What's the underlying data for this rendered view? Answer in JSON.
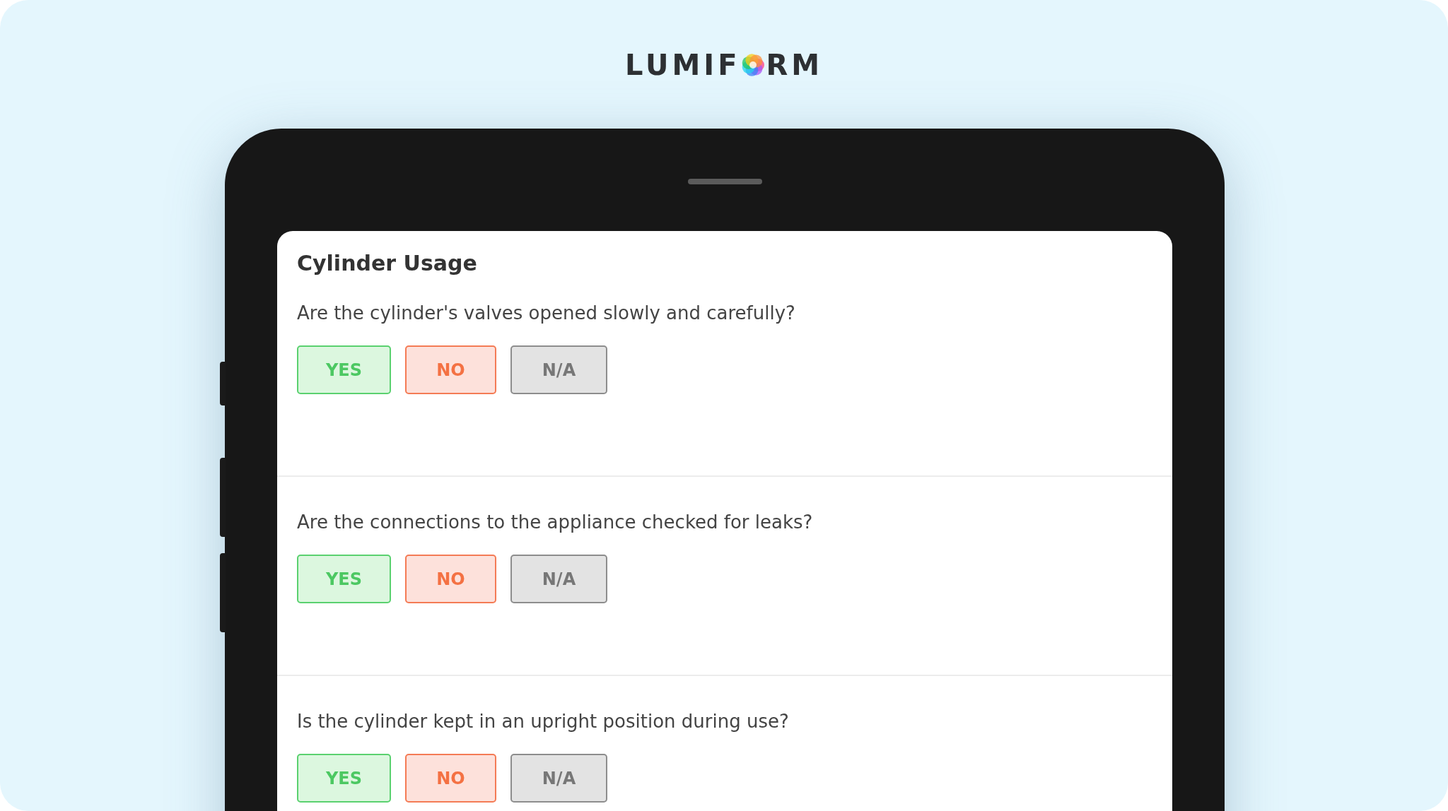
{
  "logo": {
    "before": "LUMIF",
    "after": "RM"
  },
  "form": {
    "title": "Cylinder Usage",
    "questions": [
      {
        "text": "Are the cylinder's valves opened slowly and carefully?",
        "options": [
          {
            "kind": "yes",
            "label": "YES",
            "selected": false
          },
          {
            "kind": "no",
            "label": "NO",
            "selected": false
          },
          {
            "kind": "na",
            "label": "N/A",
            "selected": false
          }
        ]
      },
      {
        "text": "Are the connections to the appliance checked for leaks?",
        "options": [
          {
            "kind": "yes",
            "label": "YES",
            "selected": false
          },
          {
            "kind": "no",
            "label": "NO",
            "selected": false
          },
          {
            "kind": "na",
            "label": "N/A",
            "selected": false
          }
        ]
      },
      {
        "text": "Is the cylinder kept in an upright position during use?",
        "options": [
          {
            "kind": "yes",
            "label": "YES",
            "selected": false
          },
          {
            "kind": "no",
            "label": "NO",
            "selected": false
          },
          {
            "kind": "na",
            "label": "N/A",
            "selected": false
          }
        ]
      }
    ]
  }
}
